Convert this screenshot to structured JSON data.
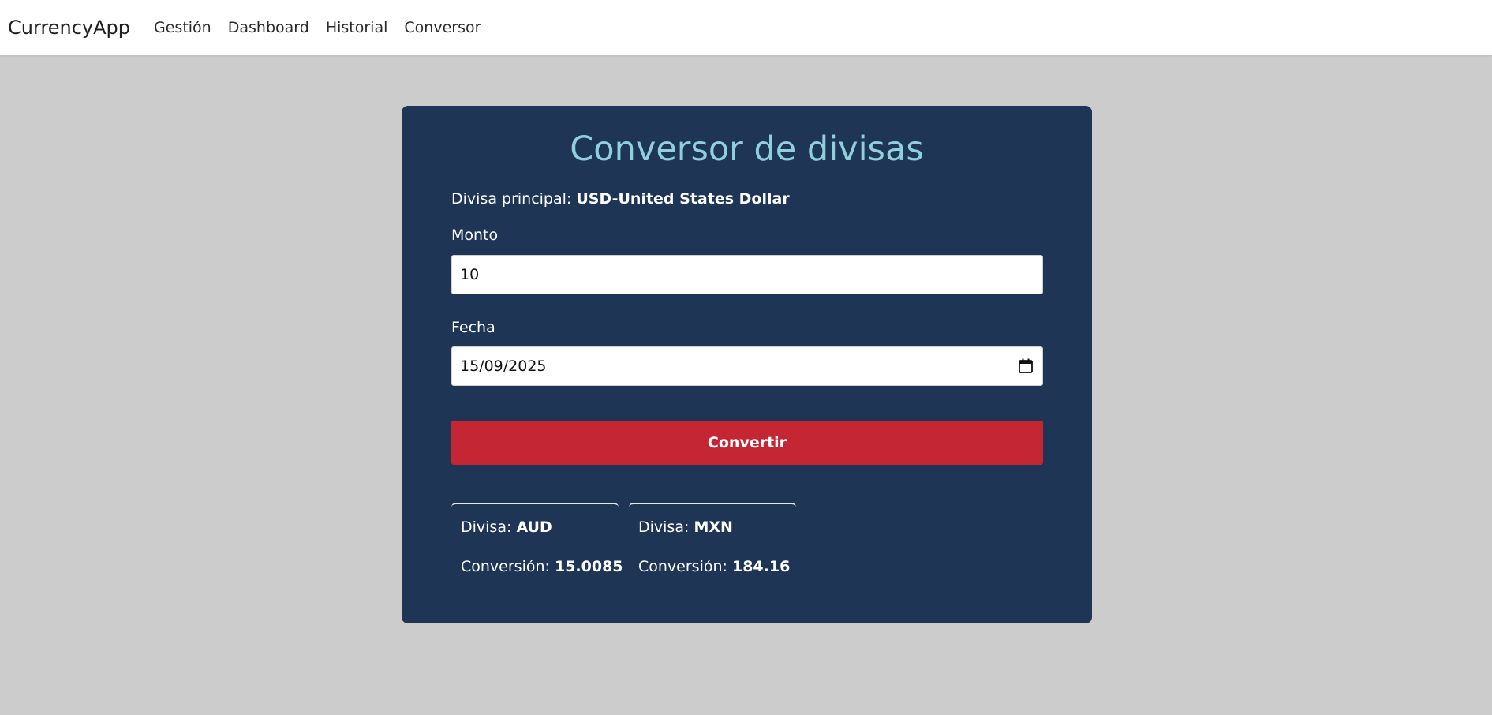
{
  "navbar": {
    "brand": "CurrencyApp",
    "items": [
      {
        "label": "Gestión"
      },
      {
        "label": "Dashboard"
      },
      {
        "label": "Historial"
      },
      {
        "label": "Conversor"
      }
    ]
  },
  "converter": {
    "title": "Conversor de divisas",
    "base_label": "Divisa principal:",
    "base_value": "USD-United States Dollar",
    "amount_label": "Monto",
    "amount_value": "10",
    "date_label": "Fecha",
    "date_value": "15/09/2025",
    "date_icon": "calendar-icon",
    "convert_label": "Convertir"
  },
  "results": [
    {
      "currency_label": "Divisa:",
      "currency": "AUD",
      "conversion_label": "Conversión:",
      "conversion": "15.0085"
    },
    {
      "currency_label": "Divisa:",
      "currency": "MXN",
      "conversion_label": "Conversión:",
      "conversion": "184.16"
    }
  ],
  "colors": {
    "background": "#cccccc",
    "card": "#1e3556",
    "title": "#8fd0dc",
    "button": "#c42733"
  }
}
